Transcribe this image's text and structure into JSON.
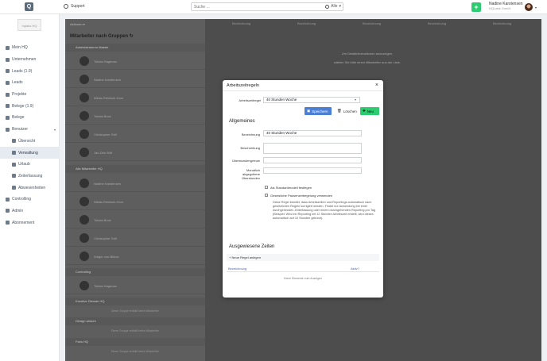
{
  "topbar": {
    "logo_text": "Q",
    "support_label": "Support",
    "search_placeholder": "Suche ...",
    "search_filter": "Alle",
    "add_label": "+",
    "user_name": "Nadine Karstensen",
    "user_company": "HQLabs GmbH"
  },
  "sidebar": {
    "company_logo": "hqlabs HQ",
    "items": [
      {
        "label": "Mein HQ"
      },
      {
        "label": "Unternehmen"
      },
      {
        "label": "Leads (1.9)"
      },
      {
        "label": "Leads"
      },
      {
        "label": "Projekte"
      },
      {
        "label": "Belege (1.9)"
      },
      {
        "label": "Belege"
      },
      {
        "label": "Benutzer"
      },
      {
        "label": "Übersicht"
      },
      {
        "label": "Verwaltung"
      },
      {
        "label": "Urlaub"
      },
      {
        "label": "Zeiterfassung"
      },
      {
        "label": "Abwesenheiten"
      },
      {
        "label": "Controlling"
      },
      {
        "label": "Admin"
      },
      {
        "label": "Abonnement"
      }
    ]
  },
  "background": {
    "toolbar_label": "Aktionen",
    "panel_title": "Mitarbeiter nach Gruppen",
    "col_heads": [
      "Bezeichnung",
      "Bezeichnung",
      "Bezeichnung",
      "Bezeichnung",
      "Bezeichnung"
    ],
    "msg1": "Um Detailinformationen anzuzeigen,",
    "msg2": "wählen Sie bitte einen Mitarbeiter aus der Liste.",
    "groups": [
      "Administratoren Master",
      "Alle Mitarbeiter HQ",
      "Controlling",
      "Kreative Dienste HQ",
      "Design wissen",
      "Fans HQ"
    ],
    "employees": [
      "Tobias Hagenau",
      "Nadine Karstensen",
      "Niklas Reinisch-Horn",
      "Tobias Bock",
      "Christopher Grill",
      "Jan-Dirk Witt",
      "Nadine Karstensen",
      "Niklas Reinisch-Horn",
      "Tobias Bock",
      "Christopher Grill",
      "Holger von Bülow",
      "Tobias Hagenau"
    ],
    "empty_text": "Diese Gruppe enthält keine Mitarbeiter"
  },
  "modal": {
    "title": "Arbeitszeitregeln",
    "close": "×",
    "rule_label": "Arbeitszeitregel",
    "rule_value": "40 Stunden Woche",
    "save_label": "Speichern",
    "delete_label": "Löschen",
    "new_label": "Neu",
    "section_general": "Allgemeines",
    "name_label": "Bezeichnung",
    "name_value": "40 Stunden Woche",
    "description_label": "Beschreibung",
    "overtime_limit_label": "Überstundengrenze",
    "monthly_overtime_label_1": "Monatlich",
    "monthly_overtime_label_2": "abgegoltene",
    "monthly_overtime_label_3": "Überstunden",
    "default_model_label": "Als Standardmodell festlegen",
    "legal_break_label": "Gesetzliche Pausenzeitregelung verwenden",
    "description_text": "Diese Regel bewirkt, dass Arbeitszeiten und Reportings automatisch nach gesetzlichen Regeln korrigiert werden. Findet nur Anwendung bei einer durchgehenden Zeiterfassung oder einem durchgehenden Reporting pro Tag (Beispiel: Wird ein Reporting mit 12 Stunden Arbeitszeit erstellt, wird dieses automatisch auf 10 Stunden gekürzt).",
    "section_times": "Ausgewiesene Zeiten",
    "add_rule_label": "Neue Regel anlegen",
    "col_name": "Bezeichnung",
    "col_active": "Aktiv?",
    "no_items": "Keine Elemente zum Anzeigen"
  }
}
